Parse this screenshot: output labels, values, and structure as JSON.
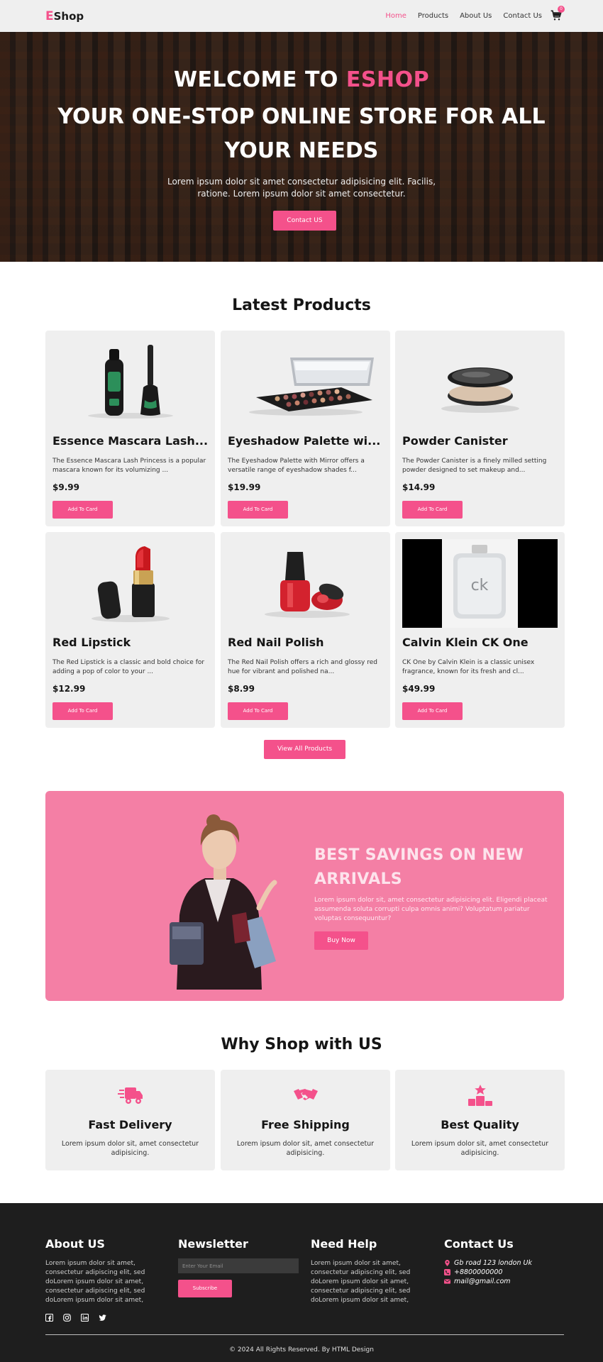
{
  "nav": {
    "logo_letter": "E",
    "logo_rest": "Shop",
    "links": [
      "Home",
      "Products",
      "About Us",
      "Contact Us"
    ],
    "cart_count": "0"
  },
  "hero": {
    "title_prefix": "WELCOME TO ",
    "title_accent": "ESHOP",
    "title_line2": "YOUR ONE-STOP ONLINE STORE FOR ALL YOUR NEEDS",
    "subtitle": "Lorem ipsum dolor sit amet consectetur adipisicing elit. Facilis, ratione. Lorem ipsum dolor sit amet consectetur.",
    "button": "Contact US"
  },
  "products": {
    "title": "Latest Products",
    "add_label": "Add To Card",
    "items": [
      {
        "name": "Essence Mascara Lash...",
        "desc": "The Essence Mascara Lash Princess is a popular mascara known for its volumizing ...",
        "price": "$9.99"
      },
      {
        "name": "Eyeshadow Palette wi...",
        "desc": "The Eyeshadow Palette with Mirror offers a versatile range of eyeshadow shades f...",
        "price": "$19.99"
      },
      {
        "name": "Powder Canister",
        "desc": "The Powder Canister is a finely milled setting powder designed to set makeup and...",
        "price": "$14.99"
      },
      {
        "name": "Red Lipstick",
        "desc": "The Red Lipstick is a classic and bold choice for adding a pop of color to your ...",
        "price": "$12.99"
      },
      {
        "name": "Red Nail Polish",
        "desc": "The Red Nail Polish offers a rich and glossy red hue for vibrant and polished na...",
        "price": "$8.99"
      },
      {
        "name": "Calvin Klein CK One",
        "desc": "CK One by Calvin Klein is a classic unisex fragrance, known for its fresh and cl...",
        "price": "$49.99"
      }
    ],
    "view_all": "View All Products",
    "bottle_label": "ck"
  },
  "promo": {
    "title": "BEST SAVINGS ON NEW ARRIVALS",
    "text": "Lorem ipsum dolor sit, amet consectetur adipisicing elit. Eligendi placeat assumenda soluta corrupti culpa omnis animi? Voluptatum pariatur voluptas consequuntur?",
    "button": "Buy Now"
  },
  "features": {
    "title": "Why Shop with US",
    "items": [
      {
        "title": "Fast Delivery",
        "text": "Lorem ipsum dolor sit, amet consectetur adipisicing.",
        "icon": "truck-icon"
      },
      {
        "title": "Free Shipping",
        "text": "Lorem ipsum dolor sit, amet consectetur adipisicing.",
        "icon": "handshake-icon"
      },
      {
        "title": "Best Quality",
        "text": "Lorem ipsum dolor sit, amet consectetur adipisicing.",
        "icon": "podium-star-icon"
      }
    ]
  },
  "footer": {
    "about_title": "About US",
    "about_text": "Lorem ipsum dolor sit amet, consectetur adipiscing elit, sed doLorem ipsum dolor sit amet, consectetur adipiscing elit, sed doLorem ipsum dolor sit amet,",
    "newsletter_title": "Newsletter",
    "newsletter_placeholder": "Enter Your Email",
    "subscribe": "Subscribe",
    "help_title": "Need Help",
    "help_text": "Lorem ipsum dolor sit amet, consectetur adipiscing elit, sed doLorem ipsum dolor sit amet, consectetur adipiscing elit, sed doLorem ipsum dolor sit amet,",
    "contact_title": "Contact Us",
    "address": "Gb road 123 london Uk",
    "phone": "+8800000000",
    "email": "mail@gmail.com",
    "copyright": "© 2024 All Rights Reserved. By HTML Design"
  },
  "colors": {
    "accent": "#f4518b",
    "promo_bg": "#f47fa5",
    "card_bg": "#efefef",
    "footer_bg": "#1e1e1e"
  }
}
